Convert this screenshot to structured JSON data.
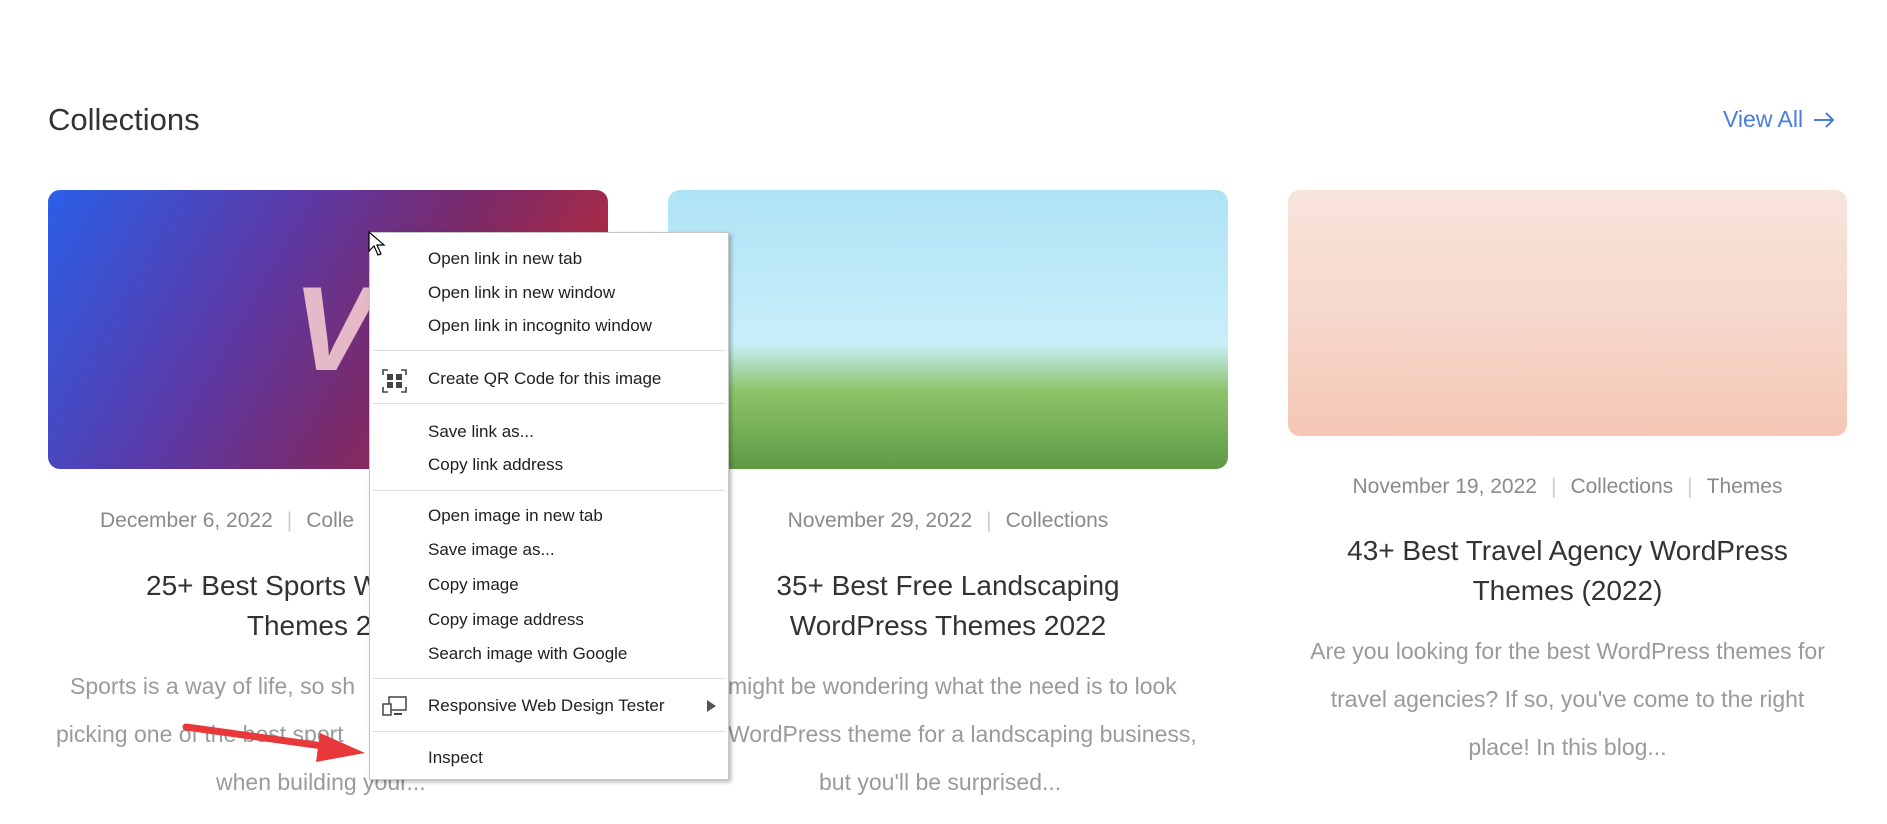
{
  "section": {
    "title": "Collections",
    "view_all": "View All",
    "view_all_icon": "arrow-right-icon",
    "accent": "#4a7de0"
  },
  "cards": [
    {
      "image_text": "VS",
      "date": "December 6, 2022",
      "category": "Colle",
      "title_lines": [
        "25+ Best Sports W",
        "Themes 2"
      ],
      "excerpt_lines": [
        "Sports is a way of life, so sh",
        "picking one of the best sport",
        "when building your..."
      ]
    },
    {
      "date": "November 29, 2022",
      "category": "Collections",
      "title_lines": [
        "35+ Best Free Landscaping",
        "WordPress Themes 2022"
      ],
      "excerpt_lines": [
        "might be wondering what the need is to look",
        "WordPress theme for a landscaping business,",
        "but you'll be surprised..."
      ]
    },
    {
      "date": "November 19, 2022",
      "category": "Collections",
      "category2": "Themes",
      "title_lines": [
        "43+ Best Travel Agency WordPress",
        "Themes (2022)"
      ],
      "excerpt_lines": [
        "Are you looking for the best WordPress themes for",
        "travel agencies? If so, you've come to the right",
        "place! In this blog..."
      ]
    }
  ],
  "context_menu": {
    "items": [
      "Open link in new tab",
      "Open link in new window",
      "Open link in incognito window",
      "Create QR Code for this image",
      "Save link as...",
      "Copy link address",
      "Open image in new tab",
      "Save image as...",
      "Copy image",
      "Copy image address",
      "Search image with Google",
      "Responsive Web Design Tester",
      "Inspect"
    ],
    "icons": {
      "qr": "qr-code-icon",
      "rwdt": "devices-icon",
      "submenu": "submenu-arrow-icon"
    }
  },
  "annotation": {
    "arrow_color": "#e8383a"
  }
}
